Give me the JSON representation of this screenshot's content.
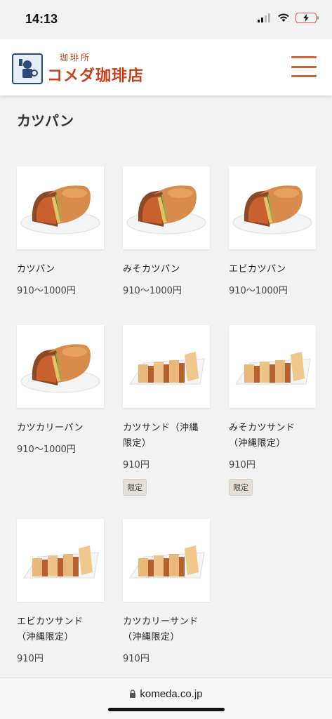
{
  "status_bar": {
    "time": "14:13"
  },
  "header": {
    "logo_sub": "珈琲所",
    "logo_main": "コメダ珈琲店",
    "menu_icon": "hamburger-icon"
  },
  "page": {
    "title": "カツパン"
  },
  "products": [
    {
      "name": "カツパン",
      "price": "910〜1000円",
      "badge": "",
      "image": "katsu-bun"
    },
    {
      "name": "みそカツパン",
      "price": "910〜1000円",
      "badge": "",
      "image": "miso-katsu-bun"
    },
    {
      "name": "エビカツパン",
      "price": "910〜1000円",
      "badge": "",
      "image": "ebi-katsu-bun"
    },
    {
      "name": "カツカリーパン",
      "price": "910〜1000円",
      "badge": "",
      "image": "katsu-curry-bun"
    },
    {
      "name": "カツサンド（沖縄\n限定）",
      "price": "910円",
      "badge": "限定",
      "image": "katsu-sandwich"
    },
    {
      "name": "みそカツサンド\n（沖縄限定）",
      "price": "910円",
      "badge": "限定",
      "image": "miso-katsu-sandwich"
    },
    {
      "name": "エビカツサンド\n（沖縄限定）",
      "price": "910円",
      "badge": "",
      "image": "ebi-katsu-sandwich"
    },
    {
      "name": "カツカリーサンド\n（沖縄限定）",
      "price": "910円",
      "badge": "",
      "image": "katsu-curry-sandwich"
    }
  ],
  "browser": {
    "url": "komeda.co.jp"
  },
  "colors": {
    "brand": "#c5411d",
    "menu": "#c5693d"
  }
}
